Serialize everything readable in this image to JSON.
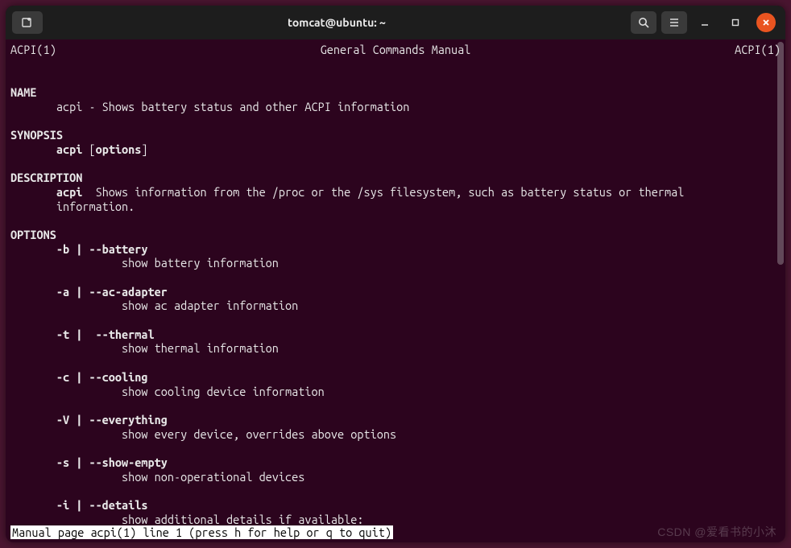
{
  "titlebar": {
    "title": "tomcat@ubuntu: ~"
  },
  "man": {
    "header_left": "ACPI(1)",
    "header_center": "General Commands Manual",
    "header_right": "ACPI(1)",
    "name_heading": "NAME",
    "name_line": "       acpi - Shows battery status and other ACPI information",
    "synopsis_heading": "SYNOPSIS",
    "synopsis_cmd": "acpi",
    "synopsis_pre": " [",
    "synopsis_opt": "options",
    "synopsis_post": "]",
    "description_heading": "DESCRIPTION",
    "description_cmd": "acpi",
    "description_text1": "  Shows information from the /proc or the /sys filesystem, such as battery status or thermal",
    "description_text2": "       information.",
    "options_heading": "OPTIONS",
    "opts": [
      {
        "flag": "-b | --battery",
        "desc": "show battery information"
      },
      {
        "flag": "-a | --ac-adapter",
        "desc": "show ac adapter information"
      },
      {
        "flag": "-t |  --thermal",
        "desc": "show thermal information"
      },
      {
        "flag": "-c | --cooling",
        "desc": "show cooling device information"
      },
      {
        "flag": "-V | --everything",
        "desc": "show every device, overrides above options"
      },
      {
        "flag": "-s | --show-empty",
        "desc": "show non-operational devices"
      },
      {
        "flag": "-i | --details",
        "desc": "show additional details if available:"
      }
    ],
    "status": " Manual page acpi(1) line 1 (press h for help or q to quit)"
  },
  "watermark": "CSDN @爱看书的小沐"
}
